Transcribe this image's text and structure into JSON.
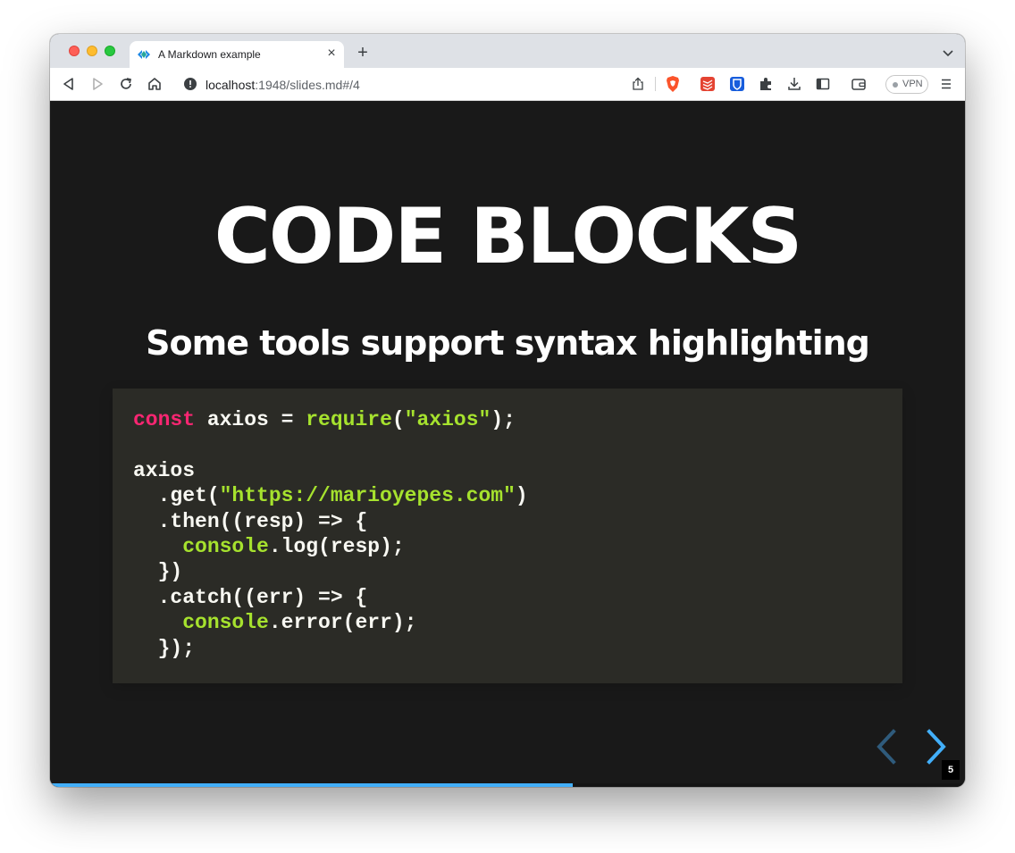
{
  "browser": {
    "tab": {
      "title": "A Markdown example",
      "close_glyph": "×"
    },
    "new_tab_glyph": "+",
    "url": {
      "host": "localhost",
      "rest": ":1948/slides.md#/4"
    },
    "vpn_label": "VPN"
  },
  "slide": {
    "title": "CODE BLOCKS",
    "subtitle": "Some tools support syntax highlighting",
    "code": {
      "language": "javascript",
      "lines": [
        "const axios = require(\"axios\");",
        "",
        "axios",
        "  .get(\"https://marioyepes.com\")",
        "  .then((resp) => {",
        "    console.log(resp);",
        "  })",
        "  .catch((err) => {",
        "    console.error(err);",
        "  });"
      ]
    },
    "slide_number": "5",
    "progress_fraction": 0.571
  },
  "colors": {
    "slide_bg": "#191919",
    "code_bg": "#2b2b26",
    "keyword": "#f92672",
    "function": "#a6e22e",
    "accent": "#42affa"
  },
  "icons": {
    "toolbar": [
      "back-icon",
      "forward-icon",
      "reload-icon",
      "home-icon",
      "info-icon",
      "share-icon",
      "brave-shield-icon",
      "todoist-icon",
      "bitwarden-icon",
      "extensions-icon",
      "download-icon",
      "sidebar-icon",
      "wallet-icon",
      "menu-icon"
    ]
  }
}
